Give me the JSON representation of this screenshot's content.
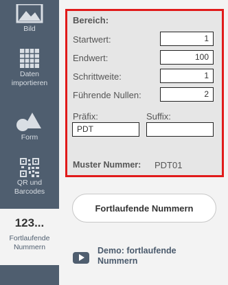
{
  "sidebar": {
    "items": [
      {
        "label": "Bild",
        "icon": "image-icon"
      },
      {
        "label": "Daten importieren",
        "icon": "spreadsheet-icon"
      },
      {
        "label": "Form",
        "icon": "shapes-icon"
      },
      {
        "label": "QR und Barcodes",
        "icon": "qr-code-icon"
      },
      {
        "symbol": "123...",
        "label": "Fortlaufende Nummern"
      }
    ]
  },
  "range": {
    "heading": "Bereich:",
    "start_label": "Startwert:",
    "start_value": "1",
    "end_label": "Endwert:",
    "end_value": "100",
    "step_label": "Schrittweite:",
    "step_value": "1",
    "leading_label": "Führende Nullen:",
    "leading_value": "2",
    "prefix_label": "Präfix:",
    "prefix_value": "PDT",
    "suffix_label": "Suffix:",
    "suffix_value": "",
    "pattern_label": "Muster Nummer:",
    "pattern_value": "PDT01"
  },
  "actions": {
    "sequence_button": "Fortlaufende Nummern",
    "demo_line1": "Demo: fortlaufende",
    "demo_line2": "Nummern"
  },
  "colors": {
    "sidebar": "#4f5e6f",
    "highlight": "#e11a1a",
    "panel": "#e6e6e6"
  }
}
